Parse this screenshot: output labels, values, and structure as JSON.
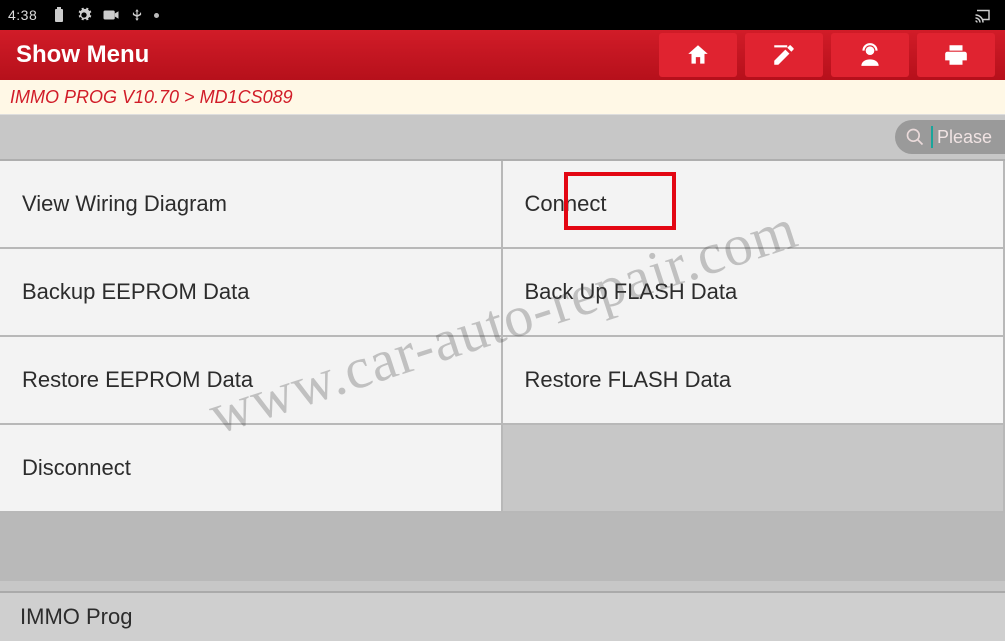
{
  "status_bar": {
    "time": "4:38"
  },
  "header": {
    "title": "Show Menu"
  },
  "breadcrumb": "IMMO PROG V10.70 > MD1CS089",
  "search": {
    "placeholder": "Please "
  },
  "menu": {
    "r0c0": "View Wiring Diagram",
    "r0c1": "Connect",
    "r1c0": "Backup EEPROM Data",
    "r1c1": "Back Up FLASH Data",
    "r2c0": "Restore EEPROM Data",
    "r2c1": "Restore FLASH Data",
    "r3c0": "Disconnect"
  },
  "footer": {
    "label": "IMMO Prog"
  },
  "watermark": "www.car-auto-repair.com"
}
